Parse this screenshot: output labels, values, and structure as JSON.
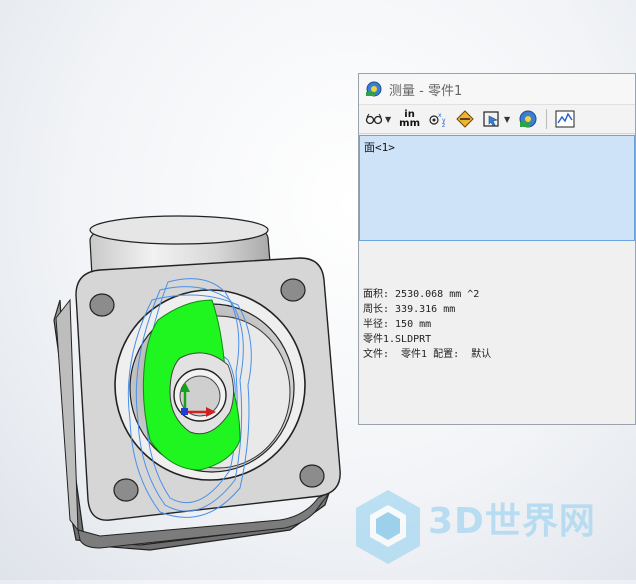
{
  "window": {
    "title": "测量 - 零件1"
  },
  "toolbar": {
    "items": [
      {
        "icon": "glasses-icon",
        "has_dropdown": true
      },
      {
        "icon": "units-icon",
        "label_top": "in",
        "label_bottom": "mm"
      },
      {
        "icon": "xyz-projection-icon"
      },
      {
        "icon": "point-measure-icon"
      },
      {
        "icon": "cursor-select-icon",
        "has_dropdown": true
      },
      {
        "icon": "measure-history-icon"
      },
      {
        "icon": "sensor-graph-icon"
      }
    ]
  },
  "selection": {
    "items": [
      "面<1>"
    ]
  },
  "results": {
    "lines": [
      "面积: 2530.068 mm ^2",
      "周长: 339.316 mm",
      "半径: 150 mm",
      "零件1.SLDPRT",
      "文件:  零件1 配置:  默认"
    ]
  },
  "watermark": {
    "text": "3D世界网"
  },
  "colors": {
    "selected_face": "#1ff51f",
    "panel_bg": "#f0f0f0",
    "selection_bg": "#cfe3f8",
    "part_gray": "#d4d4d4"
  }
}
